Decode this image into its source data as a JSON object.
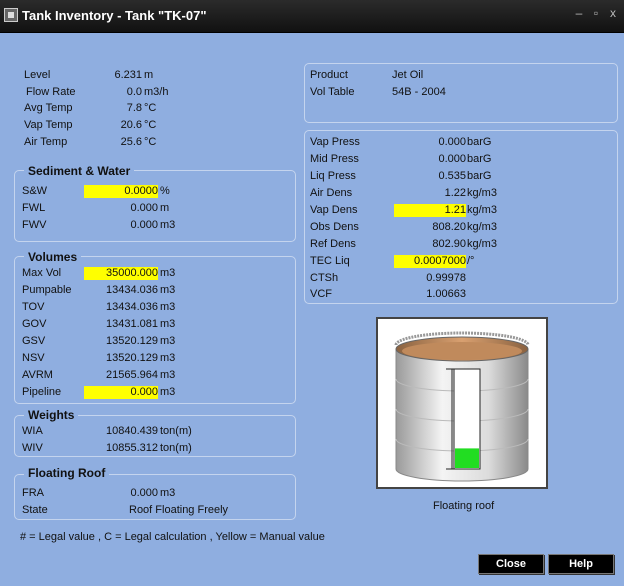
{
  "window": {
    "title": "Tank Inventory - Tank \"TK-07\"",
    "min_glyph": "–",
    "max_glyph": "▫",
    "close_glyph": "x"
  },
  "levels": [
    {
      "label": "Level",
      "value": "6.231",
      "unit": "m"
    },
    {
      "label": "Flow Rate",
      "value": "0.0",
      "unit": "m3/h"
    },
    {
      "label": "Avg Temp",
      "value": "7.8",
      "unit": "°C"
    },
    {
      "label": "Vap Temp",
      "value": "20.6",
      "unit": "°C"
    },
    {
      "label": "Air Temp",
      "value": "25.6",
      "unit": "°C"
    }
  ],
  "sediment": {
    "title": "Sediment & Water",
    "rows": [
      {
        "label": "S&W",
        "value": "0.0000",
        "unit": "%"
      },
      {
        "label": "FWL",
        "value": "0.000",
        "unit": "m"
      },
      {
        "label": "FWV",
        "value": "0.000",
        "unit": "m3"
      }
    ]
  },
  "volumes": {
    "title": "Volumes",
    "rows": [
      {
        "label": "Max Vol",
        "value": "35000.000",
        "unit": "m3"
      },
      {
        "label": "Pumpable",
        "value": "13434.036",
        "unit": "m3"
      },
      {
        "label": "TOV",
        "value": "13434.036",
        "unit": "m3"
      },
      {
        "label": "GOV",
        "value": "13431.081",
        "unit": "m3"
      },
      {
        "label": "GSV",
        "value": "13520.129",
        "unit": "m3"
      },
      {
        "label": "NSV",
        "value": "13520.129",
        "unit": "m3"
      },
      {
        "label": "AVRM",
        "value": "21565.964",
        "unit": "m3"
      },
      {
        "label": "Pipeline",
        "value": "0.000",
        "unit": "m3"
      }
    ]
  },
  "weights": {
    "title": "Weights",
    "rows": [
      {
        "label": "WIA",
        "value": "10840.439",
        "unit": "ton(m)"
      },
      {
        "label": "WIV",
        "value": "10855.312",
        "unit": "ton(m)"
      }
    ]
  },
  "floating_roof": {
    "title": "Floating Roof",
    "fra_label": "FRA",
    "fra_value": "0.000",
    "fra_unit": "m3",
    "state_label": "State",
    "state_value": "Roof Floating Freely"
  },
  "product": {
    "product_label": "Product",
    "product_value": "Jet Oil",
    "table_label": "Vol Table",
    "table_value": "54B - 2004"
  },
  "properties": [
    {
      "label": "Vap Press",
      "value": "0.000",
      "unit": "barG"
    },
    {
      "label": "Mid Press",
      "value": "0.000",
      "unit": "barG"
    },
    {
      "label": "Liq Press",
      "value": "0.535",
      "unit": "barG"
    },
    {
      "label": "Air Dens",
      "value": "1.22",
      "unit": "kg/m3"
    },
    {
      "label": "Vap Dens",
      "value": "1.21",
      "unit": "kg/m3"
    },
    {
      "label": "Obs Dens",
      "value": "808.20",
      "unit": "kg/m3"
    },
    {
      "label": "Ref Dens",
      "value": "802.90",
      "unit": "kg/m3"
    },
    {
      "label": "TEC Liq",
      "value": "0.0007000",
      "unit": "/°"
    },
    {
      "label": "CTSh",
      "value": "0.99978",
      "unit": ""
    },
    {
      "label": "VCF",
      "value": "1.00663",
      "unit": ""
    }
  ],
  "tank_graphic": {
    "caption": "Floating roof",
    "level_fraction": 0.2
  },
  "legend": "# = Legal value , C = Legal calculation , Yellow = Manual value",
  "buttons": {
    "close": "Close",
    "help": "Help"
  },
  "colors": {
    "background": "#8faee0",
    "manual_value": "#ffff00",
    "liquid": "#22dd22"
  }
}
